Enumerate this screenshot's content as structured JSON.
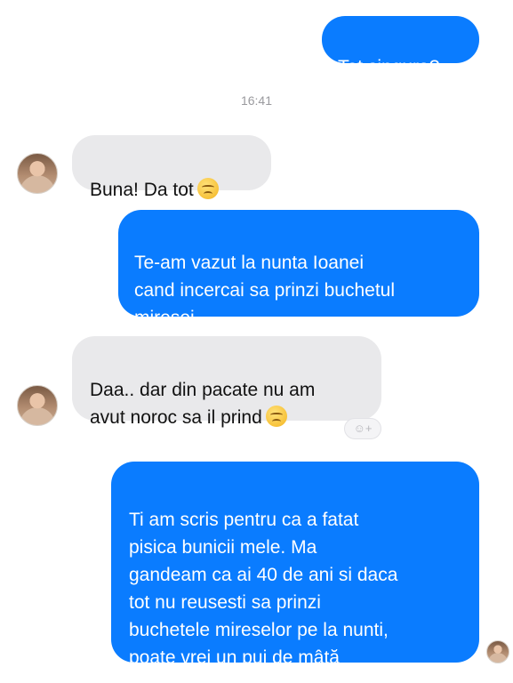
{
  "conversation": {
    "timestamp": "16:41",
    "messages": [
      {
        "direction": "outgoing",
        "text": "Tot singura?"
      },
      {
        "direction": "incoming",
        "text": "Buna! Da tot",
        "emoji": "relieved-face"
      },
      {
        "direction": "outgoing",
        "text": "Te-am vazut la nunta Ioanei\ncand incercai sa prinzi buchetul\nmiresei.."
      },
      {
        "direction": "incoming",
        "text": "Daa.. dar din pacate nu am\navut noroc sa il prind",
        "emoji": "pensive-face"
      },
      {
        "direction": "outgoing",
        "text": "Ti am scris pentru ca a fatat\npisica bunicii mele. Ma\ngandeam ca ai 40 de ani si daca\ntot nu reusesti sa prinzi\nbuchetele mireselor pe la nunti,\npoate vrei un pui de mâță"
      }
    ],
    "reaction_button": {
      "icon": "smiley-add-icon",
      "label": "☺+"
    }
  },
  "colors": {
    "outgoing_bubble": "#0a7cff",
    "incoming_bubble": "#e9e9eb",
    "timestamp_text": "#9a9a9e"
  }
}
